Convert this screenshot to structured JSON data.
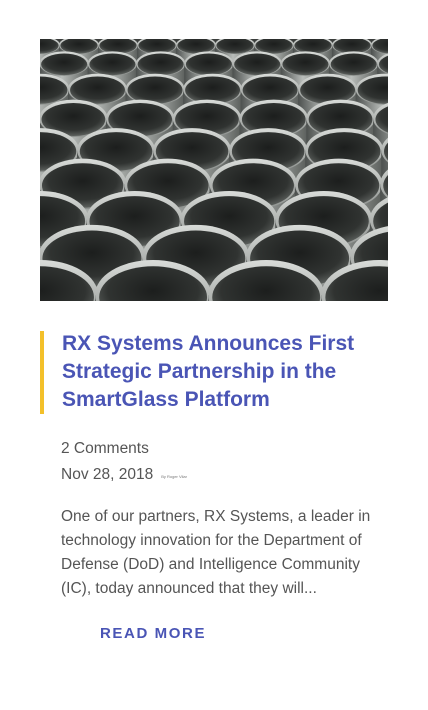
{
  "post": {
    "image_alt": "Stacked stainless steel pipes",
    "title": "RX Systems Announces First Strategic Partnership in the SmartGlass Platform",
    "comments": "2 Comments",
    "date": "Nov 28, 2018",
    "byline": "By Roger Vilar",
    "excerpt": "One of our partners, RX Systems, a leader in technology innovation for the Department of Defense (DoD) and Intelligence Community (IC), today announced that they will...",
    "read_more": "READ MORE"
  },
  "colors": {
    "accent_blue": "#4a55b5",
    "accent_yellow": "#f3c02a",
    "body_text": "#555555"
  }
}
